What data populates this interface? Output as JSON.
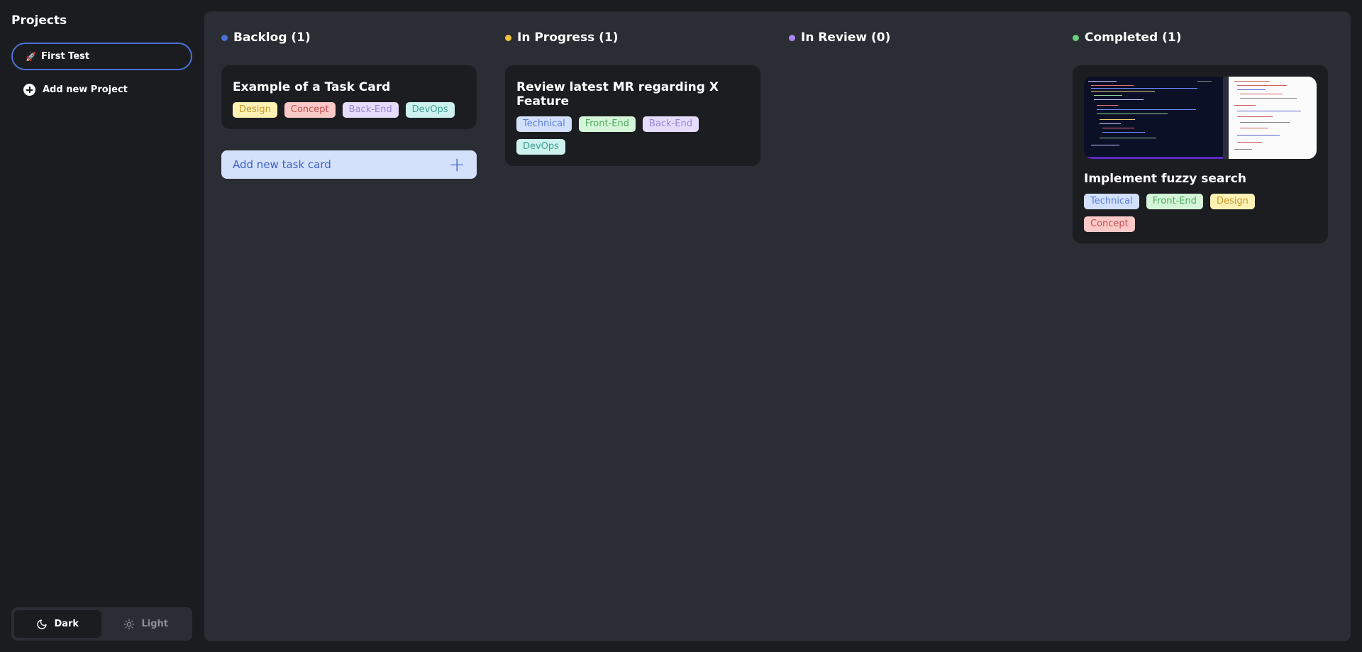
{
  "sidebar": {
    "title": "Projects",
    "projects": [
      {
        "icon": "🚀",
        "name": "First Test"
      }
    ],
    "add_project_label": "Add new Project",
    "theme": {
      "dark_label": "Dark",
      "light_label": "Light",
      "selected": "Dark"
    }
  },
  "columns": [
    {
      "title": "Backlog (1)",
      "dot_color": "#4a72d6",
      "cards": [
        {
          "title": "Example of a Task Card",
          "tags": [
            "Design",
            "Concept",
            "Back-End",
            "DevOps"
          ]
        }
      ],
      "add_card_label": "Add new task card"
    },
    {
      "title": "In Progress (1)",
      "dot_color": "#f2c339",
      "cards": [
        {
          "title": "Review latest MR regarding X Feature",
          "tags": [
            "Technical",
            "Front-End",
            "Back-End",
            "DevOps"
          ]
        }
      ]
    },
    {
      "title": "In Review (0)",
      "dot_color": "#b184f0",
      "cards": []
    },
    {
      "title": "Completed (1)",
      "dot_color": "#66cf7a",
      "cards": [
        {
          "title": "Implement fuzzy search",
          "has_image": true,
          "tags": [
            "Technical",
            "Front-End",
            "Design",
            "Concept"
          ]
        }
      ]
    }
  ],
  "icons": {
    "project": "rocket-icon",
    "add_project": "plus-circle-icon",
    "add_card": "plus-icon",
    "dark": "moon-icon",
    "light": "sun-icon"
  }
}
